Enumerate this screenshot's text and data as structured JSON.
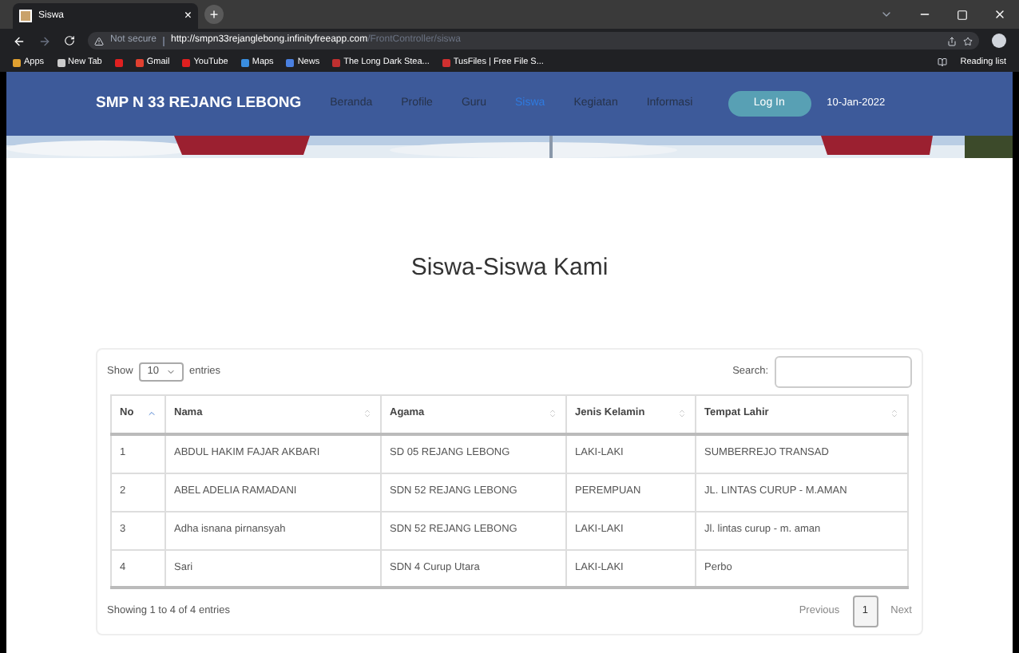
{
  "browser": {
    "tab_title": "Siswa",
    "tab_close": "×",
    "new_tab": "+",
    "url_warning": "Not secure",
    "url_host": "http://smpn33rejanglebong.infinityfreeapp.com",
    "url_path": "/FrontController/siswa",
    "bookmarks": [
      {
        "label": "Apps",
        "color": "#e0a030"
      },
      {
        "label": "New Tab",
        "color": "#cccccc"
      },
      {
        "color": "#e02020"
      },
      {
        "label": "Gmail",
        "color": "#e04030"
      },
      {
        "label": "YouTube",
        "color": "#e02020"
      },
      {
        "label": "Maps",
        "color": "#3a8ee0"
      },
      {
        "label": "News",
        "color": "#4a80e0"
      },
      {
        "label": "The Long Dark Stea...",
        "color": "#c03030"
      },
      {
        "label": "TusFiles | Free File S...",
        "color": "#d03030"
      }
    ],
    "reading_list": "Reading list"
  },
  "site": {
    "brand": "SMP N 33 REJANG LEBONG",
    "menu": [
      {
        "label": "Beranda",
        "selected": false
      },
      {
        "label": "Profile",
        "selected": false
      },
      {
        "label": "Guru",
        "selected": false
      },
      {
        "label": "Siswa",
        "selected": true
      },
      {
        "label": "Kegiatan",
        "selected": false
      },
      {
        "label": "Informasi",
        "selected": false
      }
    ],
    "login": "Log In",
    "date": "10-Jan-2022"
  },
  "page_title": "Siswa-Siswa Kami",
  "table": {
    "show_label": "Show",
    "page_size": "10",
    "entries_label": "entries",
    "search_label": "Search:",
    "columns": [
      {
        "label": "No",
        "sorted": true
      },
      {
        "label": "Nama",
        "sorted": false
      },
      {
        "label": "Agama",
        "sorted": false
      },
      {
        "label": "Jenis Kelamin",
        "sorted": false
      },
      {
        "label": "Tempat Lahir",
        "sorted": false
      }
    ],
    "rows": [
      [
        "1",
        "ABDUL HAKIM FAJAR AKBARI",
        "SD 05 REJANG LEBONG",
        "LAKI-LAKI",
        "SUMBERREJO TRANSAD"
      ],
      [
        "2",
        "ABEL ADELIA RAMADANI",
        "SDN 52 REJANG LEBONG",
        "PEREMPUAN",
        "JL. LINTAS CURUP - M.AMAN"
      ],
      [
        "3",
        "Adha isnana pirnansyah",
        "SDN 52 REJANG LEBONG",
        "LAKI-LAKI",
        "Jl. lintas curup - m. aman"
      ],
      [
        "4",
        "Sari",
        "SDN 4 Curup Utara",
        "LAKI-LAKI",
        "Perbo"
      ]
    ],
    "info": "Showing 1 to 4 of 4 entries",
    "previous": "Previous",
    "pages": [
      {
        "label": "1",
        "selected": true
      }
    ],
    "next": "Next"
  }
}
